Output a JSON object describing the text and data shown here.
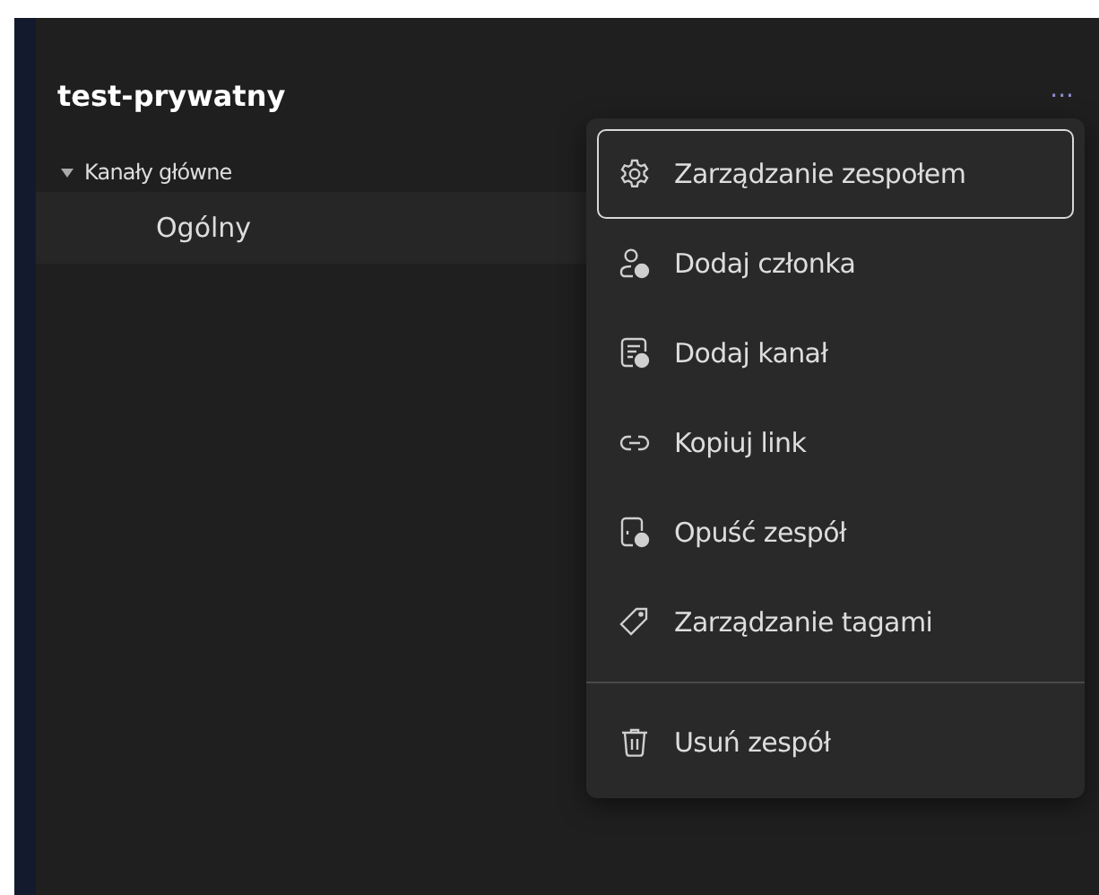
{
  "team": {
    "name": "test-prywatny",
    "more_button": "···"
  },
  "channel_groups": [
    {
      "label": "Kanały główne",
      "expanded": true,
      "children": [
        {
          "label": "Ogólny",
          "selected": true
        }
      ]
    }
  ],
  "menu": {
    "items": [
      {
        "label": "Zarządzanie zespołem",
        "selected": true
      },
      {
        "label": "Dodaj członka",
        "selected": false
      },
      {
        "label": "Dodaj kanał",
        "selected": false
      },
      {
        "label": "Kopiuj link",
        "selected": false
      },
      {
        "label": "Opuść zespół",
        "selected": false
      },
      {
        "label": "Zarządzanie tagami",
        "selected": false
      }
    ],
    "bottom_items": [
      {
        "label": "Usuń zespół",
        "selected": false
      }
    ]
  }
}
